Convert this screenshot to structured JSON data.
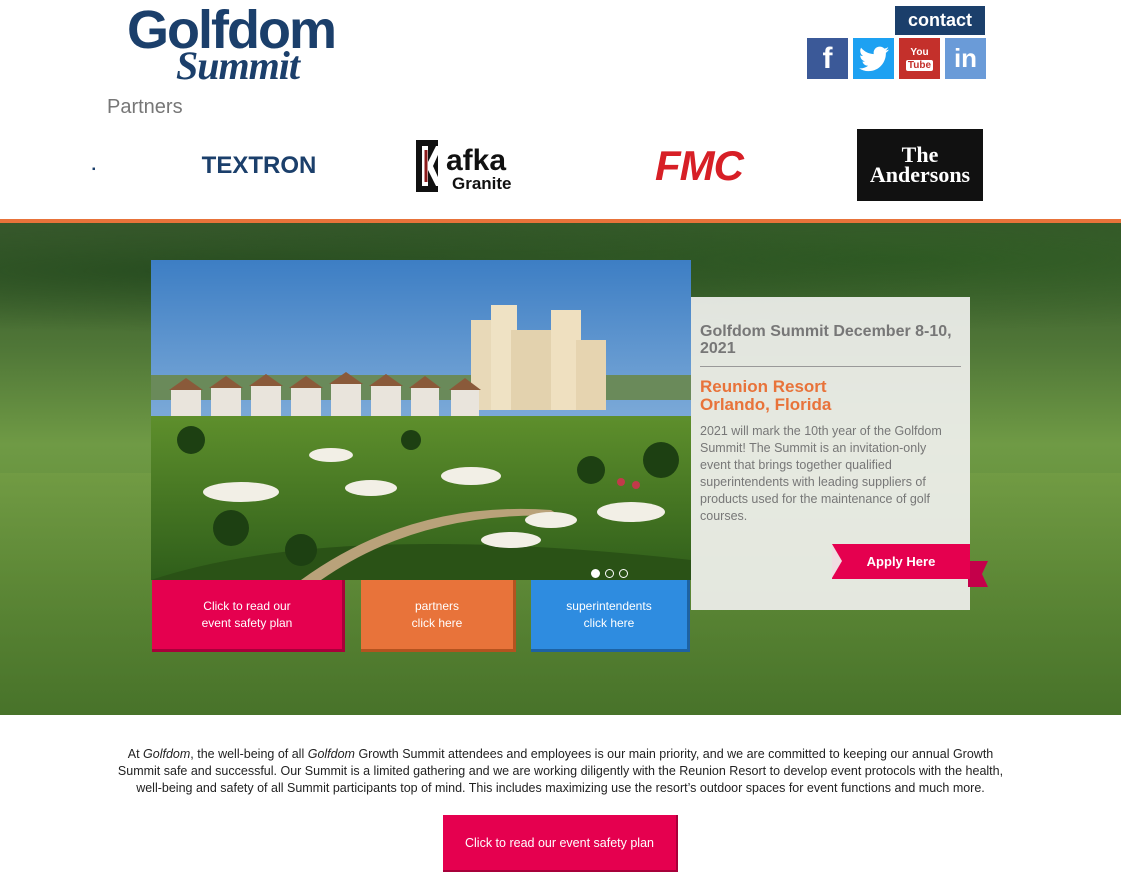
{
  "header": {
    "logo_line1": "Golfdom",
    "logo_line2": "Summit",
    "partners_label": "Partners",
    "contact_label": "contact",
    "social": {
      "facebook": "f",
      "twitter": "twitter-bird-icon",
      "youtube_line1": "You",
      "youtube_line2": "Tube",
      "linkedin": "in"
    }
  },
  "partners": [
    {
      "name": "TEXTRON"
    },
    {
      "name_line1": "afka",
      "name_line2": "Granite"
    },
    {
      "name": "FMC"
    },
    {
      "name_line1": "The",
      "name_line2": "Andersons"
    }
  ],
  "event": {
    "title": "Golfdom Summit December 8-10, 2021",
    "venue_line1": "Reunion Resort",
    "venue_line2": "Orlando, Florida",
    "description": "2021 will mark the 10th year of the Golfdom Summit! The Summit is an invitation-only event that brings together qualified superintendents with leading suppliers of products used for the maintenance of golf courses.",
    "apply_label": "Apply Here"
  },
  "slider": {
    "dots": 3,
    "active_index": 0
  },
  "hero_buttons": [
    {
      "line1": "Click to read our",
      "line2": "event safety plan"
    },
    {
      "line1": "partners",
      "line2": "click here"
    },
    {
      "line1": "superintendents",
      "line2": "click here"
    }
  ],
  "statement": {
    "part1": "At ",
    "em1": "Golfdom",
    "part2": ", the well-being of all ",
    "em2": "Golfdom",
    "part3": " Growth Summit attendees and employees is our main priority, and we are committed to keeping our annual Growth Summit safe and successful. Our Summit is a limited gathering and we are working diligently with the Reunion Resort to develop event protocols with the health, well-being and safety of all Summit participants top of mind. This includes maximizing use the resort’s outdoor spaces for event functions and much more."
  },
  "safety_button_label": "Click to read our event safety plan",
  "colors": {
    "navy": "#1b3f6b",
    "orange": "#e8733a",
    "pink": "#e5004f",
    "blue": "#2e8ce0"
  }
}
